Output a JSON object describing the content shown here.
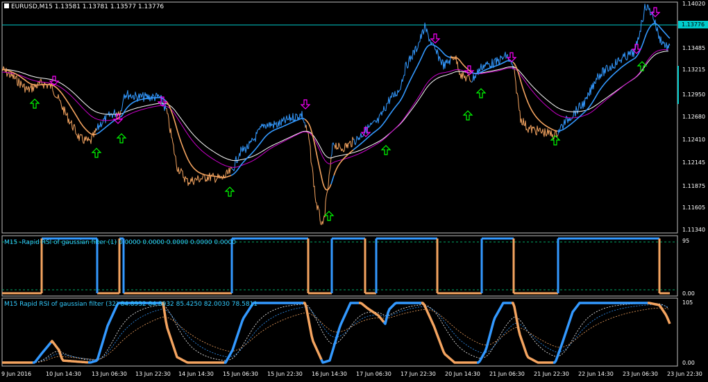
{
  "main": {
    "title": "EURUSD,M15  1.13581 1.13781 1.13577 1.13776",
    "current_price": "1.13776",
    "price_ticks": [
      "1.14020",
      "1.13485",
      "1.13215",
      "1.12950",
      "1.12680",
      "1.12410",
      "1.12145",
      "1.11875",
      "1.11605",
      "1.11340"
    ]
  },
  "sub1": {
    "title": "M15 -Rapid RSI of gaussian filter (1) 0.0000 0.0000 0.0000 0.0000 0.0000",
    "ticks": [
      "95",
      "0.00"
    ]
  },
  "sub2": {
    "title": "M15  Rapid RSI of gaussian filter (32) 84.8932 84.8932 85.4250 82.0030 78.5811",
    "ticks": [
      "105",
      "0.00"
    ]
  },
  "time_axis": [
    "9 Jun 2016",
    "10 Jun 14:30",
    "13 Jun 06:30",
    "13 Jun 22:30",
    "14 Jun 14:30",
    "15 Jun 06:30",
    "15 Jun 22:30",
    "16 Jun 14:30",
    "17 Jun 06:30",
    "17 Jun 22:30",
    "20 Jun 14:30",
    "21 Jun 06:30",
    "21 Jun 22:30",
    "22 Jun 14:30",
    "23 Jun 06:30",
    "23 Jun 22:30"
  ],
  "colors": {
    "up": "#3399ff",
    "down": "#f4a460",
    "buy_arrow": "#00ff00",
    "sell_arrow": "#ff00ff",
    "frame": "#c0c0c0",
    "grid": "#00aa66",
    "price_line": "#00cccc"
  }
}
